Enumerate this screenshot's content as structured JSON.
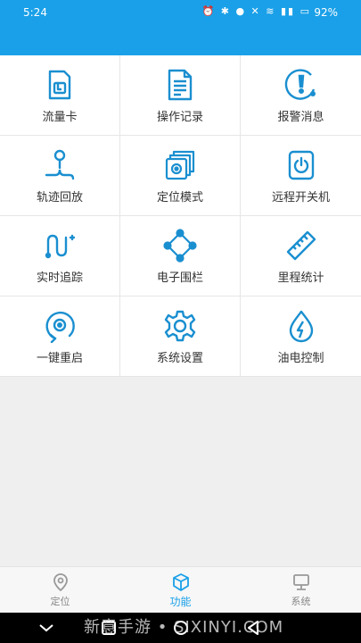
{
  "status_bar": {
    "time": "5:24",
    "battery": "92%"
  },
  "colors": {
    "accent": "#1aa0e8",
    "icon": "#1a8fd0",
    "label": "#333333"
  },
  "grid": [
    {
      "label": "流量卡",
      "icon": "sim-card-icon"
    },
    {
      "label": "操作记录",
      "icon": "document-list-icon"
    },
    {
      "label": "报警消息",
      "icon": "alarm-icon"
    },
    {
      "label": "轨迹回放",
      "icon": "track-replay-icon"
    },
    {
      "label": "定位模式",
      "icon": "location-mode-icon"
    },
    {
      "label": "远程开关机",
      "icon": "power-icon"
    },
    {
      "label": "实时追踪",
      "icon": "realtime-track-icon"
    },
    {
      "label": "电子围栏",
      "icon": "geofence-icon"
    },
    {
      "label": "里程统计",
      "icon": "ruler-icon"
    },
    {
      "label": "一键重启",
      "icon": "restart-icon"
    },
    {
      "label": "系统设置",
      "icon": "gear-icon"
    },
    {
      "label": "油电控制",
      "icon": "fuel-power-icon"
    }
  ],
  "tabs": [
    {
      "label": "定位",
      "icon": "location-pin-icon",
      "active": false
    },
    {
      "label": "功能",
      "icon": "cube-icon",
      "active": true
    },
    {
      "label": "系统",
      "icon": "monitor-icon",
      "active": false
    }
  ],
  "watermark": "新意手游 • SIXINYI.COM"
}
